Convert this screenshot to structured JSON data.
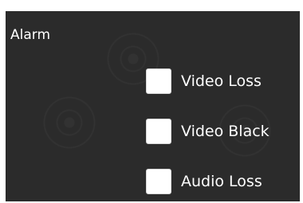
{
  "section": {
    "title": "Alarm"
  },
  "options": [
    {
      "label": "Video Loss",
      "checked": false
    },
    {
      "label": "Video Black",
      "checked": false
    },
    {
      "label": "Audio Loss",
      "checked": false
    }
  ]
}
